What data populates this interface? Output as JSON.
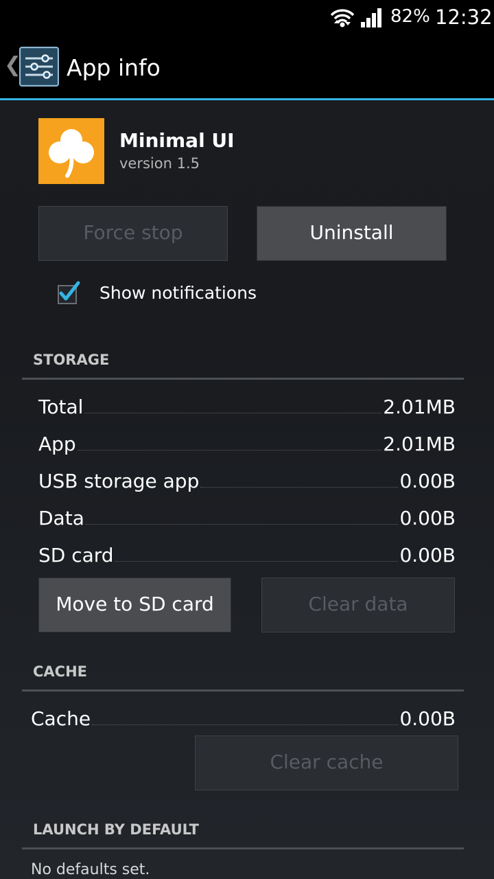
{
  "status_bar": {
    "battery": "82%",
    "time": "12:32",
    "icons": [
      "wifi-icon",
      "signal-icon"
    ]
  },
  "action_bar": {
    "title": "App info",
    "icon": "settings-sliders-icon",
    "accent_color": "#33b5e5"
  },
  "app": {
    "name": "Minimal UI",
    "version": "version 1.5",
    "icon": "clover-icon",
    "icon_color": "#f6a21e"
  },
  "buttons": {
    "force_stop": "Force stop",
    "uninstall": "Uninstall",
    "move_to_sd": "Move to SD card",
    "clear_data": "Clear data",
    "clear_cache": "Clear cache"
  },
  "notifications": {
    "label": "Show notifications",
    "checked": true
  },
  "storage": {
    "header": "STORAGE",
    "rows": [
      {
        "label": "Total",
        "value": "2.01MB"
      },
      {
        "label": "App",
        "value": "2.01MB"
      },
      {
        "label": "USB storage app",
        "value": "0.00B"
      },
      {
        "label": "Data",
        "value": "0.00B"
      },
      {
        "label": "SD card",
        "value": "0.00B"
      }
    ]
  },
  "cache": {
    "header": "CACHE",
    "label": "Cache",
    "value": "0.00B"
  },
  "launch": {
    "header": "LAUNCH BY DEFAULT",
    "text": "No defaults set."
  }
}
